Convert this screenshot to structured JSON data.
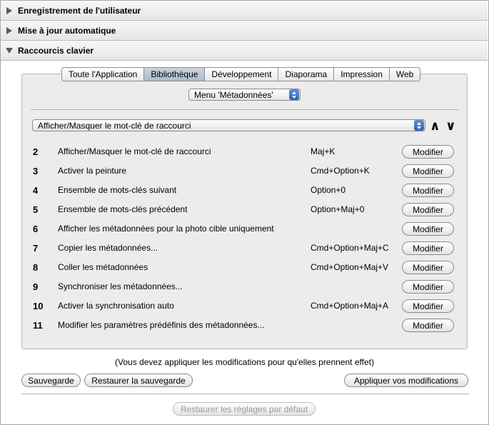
{
  "sections": [
    {
      "title": "Enregistrement de l'utilisateur",
      "expanded": false
    },
    {
      "title": "Mise à jour automatique",
      "expanded": false
    },
    {
      "title": "Raccourcis clavier",
      "expanded": true
    }
  ],
  "tabs": [
    "Toute l'Application",
    "Bibliothèque",
    "Développement",
    "Diaporama",
    "Impression",
    "Web"
  ],
  "active_tab": "Bibliothèque",
  "menu_select": "Menu 'Métadonnées'",
  "command_select": "Afficher/Masquer le mot-clé de raccourci",
  "shortcuts": [
    {
      "num": "2",
      "label": "Afficher/Masquer le mot-clé de raccourci",
      "shortcut": "Maj+K",
      "button": "Modifier"
    },
    {
      "num": "3",
      "label": "Activer la peinture",
      "shortcut": "Cmd+Option+K",
      "button": "Modifier"
    },
    {
      "num": "4",
      "label": "Ensemble de mots-clés suivant",
      "shortcut": "Option+0",
      "button": "Modifier"
    },
    {
      "num": "5",
      "label": "Ensemble de mots-clés précédent",
      "shortcut": "Option+Maj+0",
      "button": "Modifier"
    },
    {
      "num": "6",
      "label": "Afficher les métadonnées pour la photo cible uniquement",
      "shortcut": "",
      "button": "Modifier"
    },
    {
      "num": "7",
      "label": "Copier les métadonnées...",
      "shortcut": "Cmd+Option+Maj+C",
      "button": "Modifier"
    },
    {
      "num": "8",
      "label": "Coller les métadonnées",
      "shortcut": "Cmd+Option+Maj+V",
      "button": "Modifier"
    },
    {
      "num": "9",
      "label": "Synchroniser les métadonnées...",
      "shortcut": "",
      "button": "Modifier"
    },
    {
      "num": "10",
      "label": "Activer la synchronisation auto",
      "shortcut": "Cmd+Option+Maj+A",
      "button": "Modifier"
    },
    {
      "num": "11",
      "label": "Modifier les paramètres prédéfinis des métadonnées...",
      "shortcut": "",
      "button": "Modifier"
    }
  ],
  "note": "(Vous devez appliquer les modifications pour qu'elles prennent effet)",
  "buttons": {
    "save": "Sauvegarde",
    "restore_backup": "Restaurer la sauvegarde",
    "apply": "Appliquer vos modifications",
    "restore_defaults": "Restaurer les réglages par défaut"
  }
}
